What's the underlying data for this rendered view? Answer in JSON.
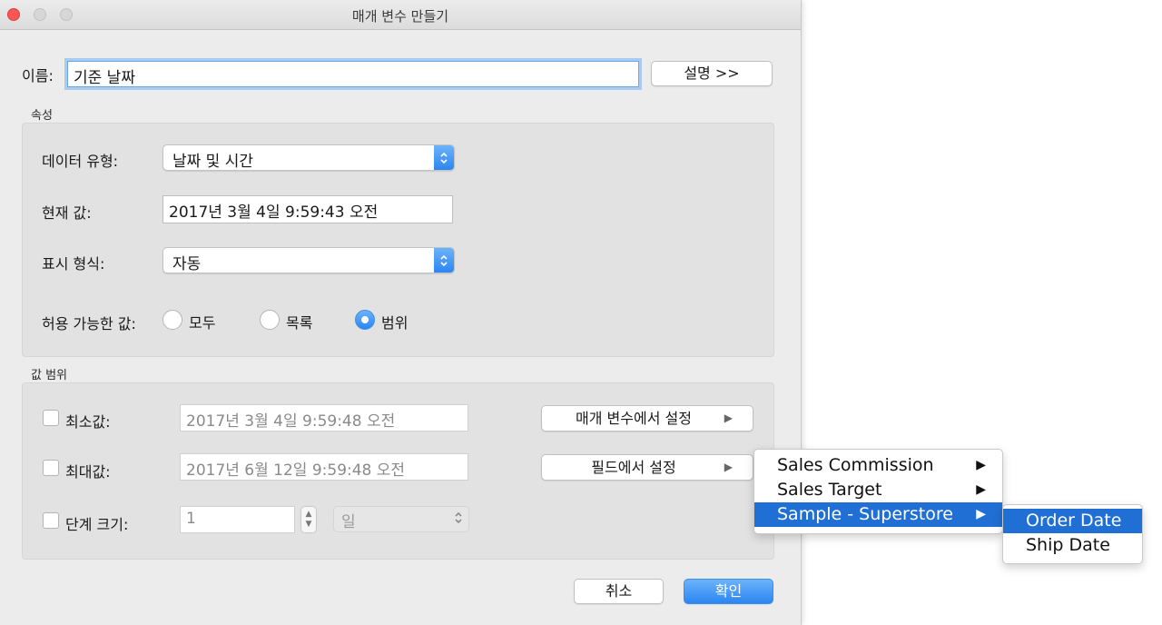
{
  "window": {
    "title": "매개 변수 만들기"
  },
  "name": {
    "label": "이름:",
    "value": "기준 날짜"
  },
  "comment_button": "설명 >>",
  "properties": {
    "section_title": "속성",
    "data_type_label": "데이터 유형:",
    "data_type_value": "날짜 및 시간",
    "current_value_label": "현재 값:",
    "current_value": "2017년 3월 4일 9:59:43 오전",
    "display_format_label": "표시 형식:",
    "display_format_value": "자동",
    "allowable_label": "허용 가능한 값:",
    "allowable_options": [
      {
        "label": "모두",
        "selected": false
      },
      {
        "label": "목록",
        "selected": false
      },
      {
        "label": "범위",
        "selected": true
      }
    ]
  },
  "range": {
    "section_title": "값 범위",
    "min_label": "최소값:",
    "min_value": "2017년 3월 4일 9:59:48 오전",
    "max_label": "최대값:",
    "max_value": "2017년 6월 12일 9:59:48 오전",
    "step_label": "단계 크기:",
    "step_value": "1",
    "step_unit": "일",
    "set_from_parameter": "매개 변수에서 설정",
    "set_from_field": "필드에서 설정"
  },
  "buttons": {
    "cancel": "취소",
    "ok": "확인"
  },
  "menu": {
    "items": [
      "Sales Commission",
      "Sales Target",
      "Sample - Superstore"
    ],
    "highlighted_index": 2
  },
  "submenu": {
    "items": [
      "Order Date",
      "Ship Date"
    ],
    "highlighted_index": 0
  },
  "colors": {
    "accent": "#2b86f2",
    "highlight": "#1f6fd4",
    "close": "#fc5753"
  }
}
